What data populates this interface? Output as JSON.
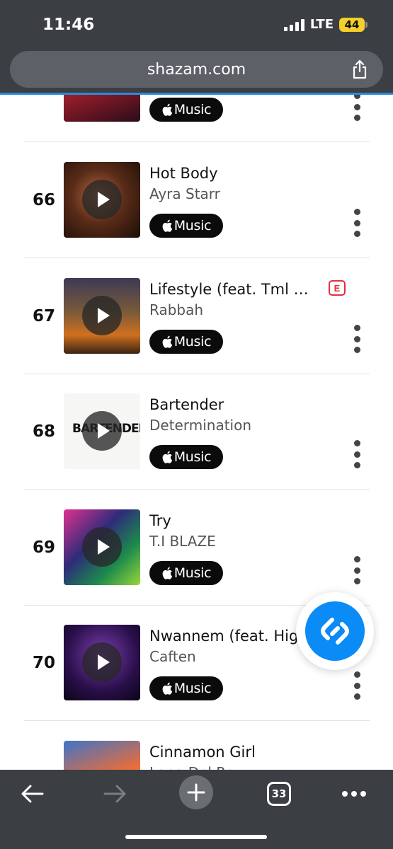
{
  "status_bar": {
    "time": "11:46",
    "network": "LTE",
    "battery": "44"
  },
  "browser": {
    "url": "shazam.com",
    "tab_count": "33"
  },
  "chart": {
    "tracks": [
      {
        "rank": "",
        "title": "",
        "artist": "",
        "button_label": "Music",
        "explicit": false
      },
      {
        "rank": "66",
        "title": "Hot Body",
        "artist": "Ayra Starr",
        "button_label": "Music",
        "explicit": false
      },
      {
        "rank": "67",
        "title": "Lifestyle (feat. Tml Vi...",
        "artist": "Rabbah",
        "button_label": "Music",
        "explicit": true,
        "explicit_label": "E"
      },
      {
        "rank": "68",
        "title": "Bartender",
        "artist": "Determination",
        "button_label": "Music",
        "explicit": false,
        "cover_text": "BARTENDER"
      },
      {
        "rank": "69",
        "title": "Try",
        "artist": "T.I BLAZE",
        "button_label": "Music",
        "explicit": false
      },
      {
        "rank": "70",
        "title": "Nwannem (feat. Hig",
        "artist": "Caften",
        "button_label": "Music",
        "explicit": false
      },
      {
        "rank": "",
        "title": "Cinnamon Girl",
        "artist": "Lana Del Rey",
        "button_label": "Music",
        "explicit": false
      }
    ]
  },
  "colors": {
    "chrome": "#3b3e43",
    "shazam_blue": "#0a8bf5",
    "explicit_red": "#e0303b",
    "button_black": "#0b0b0b"
  },
  "icons": {
    "share": "share-icon",
    "back": "back-arrow-icon",
    "forward": "forward-arrow-icon",
    "new_tab": "plus-icon",
    "tabs": "tabs-icon",
    "more": "more-icon",
    "apple": "apple-icon",
    "shazam": "shazam-logo-icon"
  }
}
